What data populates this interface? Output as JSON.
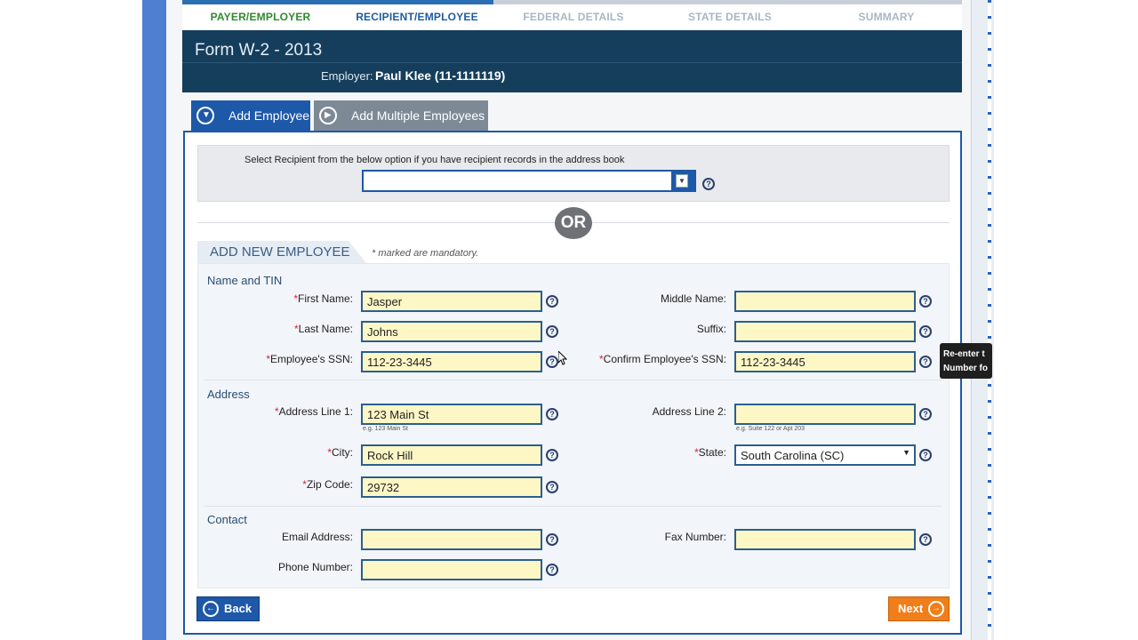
{
  "steps": [
    "PAYER/EMPLOYER",
    "RECIPIENT/EMPLOYEE",
    "FEDERAL DETAILS",
    "STATE DETAILS",
    "SUMMARY"
  ],
  "header": {
    "title": "Form W-2 - 2013",
    "employer_label": "Employer:",
    "employer_value": "Paul Klee (11-1111119)"
  },
  "tabs": {
    "add_employee": "Add Employee",
    "add_multiple": "Add Multiple Employees"
  },
  "select_recipient": {
    "label": "Select Recipient from the below option if you have recipient records in the address book",
    "value": ""
  },
  "or_label": "OR",
  "section": {
    "title": "ADD NEW EMPLOYEE",
    "mandatory_note": "* marked are mandatory."
  },
  "groups": {
    "name_tin": "Name and TIN",
    "address": "Address",
    "contact": "Contact"
  },
  "fields": {
    "first_name": {
      "label": "First Name:",
      "value": "Jasper"
    },
    "middle_name": {
      "label": "Middle Name:",
      "value": ""
    },
    "last_name": {
      "label": "Last Name:",
      "value": "Johns"
    },
    "suffix": {
      "label": "Suffix:",
      "value": ""
    },
    "ssn": {
      "label": "Employee's SSN:",
      "value": "112-23-3445"
    },
    "confirm_ssn": {
      "label": "Confirm Employee's SSN:",
      "value": "112-23-3445"
    },
    "address1": {
      "label": "Address Line 1:",
      "value": "123 Main St",
      "hint": "e.g. 123 Main St"
    },
    "address2": {
      "label": "Address Line 2:",
      "value": "",
      "hint": "e.g. Suite 122 or Apt 203"
    },
    "city": {
      "label": "City:",
      "value": "Rock Hill"
    },
    "state": {
      "label": "State:",
      "value": "South Carolina (SC)"
    },
    "zip": {
      "label": "Zip Code:",
      "value": "29732"
    },
    "email": {
      "label": "Email Address:",
      "value": ""
    },
    "fax": {
      "label": "Fax Number:",
      "value": ""
    },
    "phone": {
      "label": "Phone Number:",
      "value": ""
    }
  },
  "tooltip": {
    "line1": "Re-enter t",
    "line2": "Number fo"
  },
  "buttons": {
    "back": "Back",
    "next": "Next"
  },
  "colors": {
    "header_bg": "#153e5c",
    "accent": "#1e58a8",
    "input_bg": "#fdf7c6",
    "next_btn": "#f07e1a",
    "step_done": "#2f8a2f"
  }
}
